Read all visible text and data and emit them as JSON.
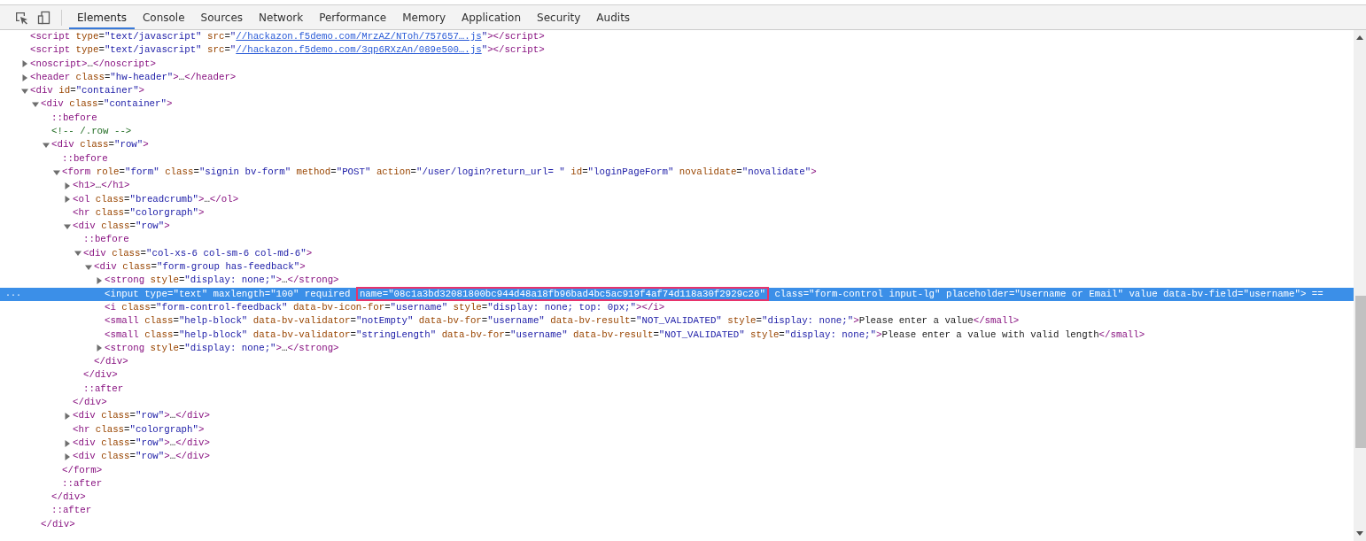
{
  "toolbar": {
    "tabs": [
      {
        "label": "Elements",
        "selected": true
      },
      {
        "label": "Console",
        "selected": false
      },
      {
        "label": "Sources",
        "selected": false
      },
      {
        "label": "Network",
        "selected": false
      },
      {
        "label": "Performance",
        "selected": false
      },
      {
        "label": "Memory",
        "selected": false
      },
      {
        "label": "Application",
        "selected": false
      },
      {
        "label": "Security",
        "selected": false
      },
      {
        "label": "Audits",
        "selected": false
      }
    ]
  },
  "tree": [
    {
      "selected": false,
      "line": [
        {
          "kind": "tag",
          "text": "<script"
        },
        {
          "kind": "attr",
          "text": " type"
        },
        {
          "kind": "text",
          "text": "="
        },
        {
          "kind": "val",
          "text": "\"text/javascript\""
        },
        {
          "kind": "attr",
          "text": " src"
        },
        {
          "kind": "text",
          "text": "="
        },
        {
          "kind": "val",
          "text": "\""
        },
        {
          "kind": "link",
          "text": "//hackazon.f5demo.com/MrzAZ/NToh/757657….js"
        },
        {
          "kind": "val",
          "text": "\""
        },
        {
          "kind": "tag",
          "text": "></script>"
        }
      ]
    },
    {
      "selected": false,
      "line": [
        {
          "kind": "tag",
          "text": "<script"
        },
        {
          "kind": "attr",
          "text": " type"
        },
        {
          "kind": "text",
          "text": "="
        },
        {
          "kind": "val",
          "text": "\"text/javascript\""
        },
        {
          "kind": "attr",
          "text": " src"
        },
        {
          "kind": "text",
          "text": "="
        },
        {
          "kind": "val",
          "text": "\""
        },
        {
          "kind": "link",
          "text": "//hackazon.f5demo.com/3qp6RXzAn/089e500….js"
        },
        {
          "kind": "val",
          "text": "\""
        },
        {
          "kind": "tag",
          "text": "></script>"
        }
      ]
    },
    {
      "selected": false,
      "expanded": false,
      "line": [
        {
          "kind": "tag",
          "text": "<noscript>"
        },
        {
          "kind": "text",
          "text": "…"
        },
        {
          "kind": "tag",
          "text": "</noscript>"
        }
      ]
    },
    {
      "selected": false,
      "expanded": false,
      "line": [
        {
          "kind": "tag",
          "text": "<header"
        },
        {
          "kind": "attr",
          "text": " class"
        },
        {
          "kind": "text",
          "text": "="
        },
        {
          "kind": "val",
          "text": "\"hw-header\""
        },
        {
          "kind": "tag",
          "text": ">"
        },
        {
          "kind": "text",
          "text": "…"
        },
        {
          "kind": "tag",
          "text": "</header>"
        }
      ]
    },
    {
      "selected": false,
      "expanded": true,
      "line": [
        {
          "kind": "tag",
          "text": "<div"
        },
        {
          "kind": "attr",
          "text": " id"
        },
        {
          "kind": "text",
          "text": "="
        },
        {
          "kind": "val",
          "text": "\"container\""
        },
        {
          "kind": "tag",
          "text": ">"
        }
      ],
      "children": [
        {
          "selected": false,
          "expanded": true,
          "line": [
            {
              "kind": "tag",
              "text": "<div"
            },
            {
              "kind": "attr",
              "text": " class"
            },
            {
              "kind": "text",
              "text": "="
            },
            {
              "kind": "val",
              "text": "\"container\""
            },
            {
              "kind": "tag",
              "text": ">"
            }
          ],
          "close": [
            {
              "kind": "tag",
              "text": "</div>"
            }
          ],
          "children": [
            {
              "selected": false,
              "line": [
                {
                  "kind": "pseudo",
                  "text": "::before"
                }
              ]
            },
            {
              "selected": false,
              "line": [
                {
                  "kind": "comment",
                  "text": "<!-- /.row -->"
                }
              ]
            },
            {
              "selected": false,
              "expanded": true,
              "line": [
                {
                  "kind": "tag",
                  "text": "<div"
                },
                {
                  "kind": "attr",
                  "text": " class"
                },
                {
                  "kind": "text",
                  "text": "="
                },
                {
                  "kind": "val",
                  "text": "\"row\""
                },
                {
                  "kind": "tag",
                  "text": ">"
                }
              ],
              "close": [
                {
                  "kind": "tag",
                  "text": "</div>"
                }
              ],
              "children": [
                {
                  "selected": false,
                  "line": [
                    {
                      "kind": "pseudo",
                      "text": "::before"
                    }
                  ]
                },
                {
                  "selected": false,
                  "expanded": true,
                  "line": [
                    {
                      "kind": "tag",
                      "text": "<form"
                    },
                    {
                      "kind": "attr",
                      "text": " role"
                    },
                    {
                      "kind": "text",
                      "text": "="
                    },
                    {
                      "kind": "val",
                      "text": "\"form\""
                    },
                    {
                      "kind": "attr",
                      "text": " class"
                    },
                    {
                      "kind": "text",
                      "text": "="
                    },
                    {
                      "kind": "val",
                      "text": "\"signin bv-form\""
                    },
                    {
                      "kind": "attr",
                      "text": " method"
                    },
                    {
                      "kind": "text",
                      "text": "="
                    },
                    {
                      "kind": "val",
                      "text": "\"POST\""
                    },
                    {
                      "kind": "attr",
                      "text": " action"
                    },
                    {
                      "kind": "text",
                      "text": "="
                    },
                    {
                      "kind": "val",
                      "text": "\"/user/login?return_url= \""
                    },
                    {
                      "kind": "attr",
                      "text": " id"
                    },
                    {
                      "kind": "text",
                      "text": "="
                    },
                    {
                      "kind": "val",
                      "text": "\"loginPageForm\""
                    },
                    {
                      "kind": "attr",
                      "text": " novalidate"
                    },
                    {
                      "kind": "text",
                      "text": "="
                    },
                    {
                      "kind": "val",
                      "text": "\"novalidate\""
                    },
                    {
                      "kind": "tag",
                      "text": ">"
                    }
                  ],
                  "close": [
                    {
                      "kind": "tag",
                      "text": "</form>"
                    }
                  ],
                  "children": [
                    {
                      "selected": false,
                      "expanded": false,
                      "line": [
                        {
                          "kind": "tag",
                          "text": "<h1>"
                        },
                        {
                          "kind": "text",
                          "text": "…"
                        },
                        {
                          "kind": "tag",
                          "text": "</h1>"
                        }
                      ]
                    },
                    {
                      "selected": false,
                      "expanded": false,
                      "line": [
                        {
                          "kind": "tag",
                          "text": "<ol"
                        },
                        {
                          "kind": "attr",
                          "text": " class"
                        },
                        {
                          "kind": "text",
                          "text": "="
                        },
                        {
                          "kind": "val",
                          "text": "\"breadcrumb\""
                        },
                        {
                          "kind": "tag",
                          "text": ">"
                        },
                        {
                          "kind": "text",
                          "text": "…"
                        },
                        {
                          "kind": "tag",
                          "text": "</ol>"
                        }
                      ]
                    },
                    {
                      "selected": false,
                      "line": [
                        {
                          "kind": "tag",
                          "text": "<hr"
                        },
                        {
                          "kind": "attr",
                          "text": " class"
                        },
                        {
                          "kind": "text",
                          "text": "="
                        },
                        {
                          "kind": "val",
                          "text": "\"colorgraph\""
                        },
                        {
                          "kind": "tag",
                          "text": ">"
                        }
                      ]
                    },
                    {
                      "selected": false,
                      "expanded": true,
                      "line": [
                        {
                          "kind": "tag",
                          "text": "<div"
                        },
                        {
                          "kind": "attr",
                          "text": " class"
                        },
                        {
                          "kind": "text",
                          "text": "="
                        },
                        {
                          "kind": "val",
                          "text": "\"row\""
                        },
                        {
                          "kind": "tag",
                          "text": ">"
                        }
                      ],
                      "close": [
                        {
                          "kind": "tag",
                          "text": "</div>"
                        }
                      ],
                      "children": [
                        {
                          "selected": false,
                          "line": [
                            {
                              "kind": "pseudo",
                              "text": "::before"
                            }
                          ]
                        },
                        {
                          "selected": false,
                          "expanded": true,
                          "line": [
                            {
                              "kind": "tag",
                              "text": "<div"
                            },
                            {
                              "kind": "attr",
                              "text": " class"
                            },
                            {
                              "kind": "text",
                              "text": "="
                            },
                            {
                              "kind": "val",
                              "text": "\"col-xs-6 col-sm-6 col-md-6\""
                            },
                            {
                              "kind": "tag",
                              "text": ">"
                            }
                          ],
                          "close": [
                            {
                              "kind": "tag",
                              "text": "</div>"
                            }
                          ],
                          "children": [
                            {
                              "selected": false,
                              "expanded": true,
                              "line": [
                                {
                                  "kind": "tag",
                                  "text": "<div"
                                },
                                {
                                  "kind": "attr",
                                  "text": " class"
                                },
                                {
                                  "kind": "text",
                                  "text": "="
                                },
                                {
                                  "kind": "val",
                                  "text": "\"form-group has-feedback\""
                                },
                                {
                                  "kind": "tag",
                                  "text": ">"
                                }
                              ],
                              "close": [
                                {
                                  "kind": "tag",
                                  "text": "</div>"
                                }
                              ],
                              "children": [
                                {
                                  "selected": false,
                                  "expanded": false,
                                  "line": [
                                    {
                                      "kind": "tag",
                                      "text": "<strong"
                                    },
                                    {
                                      "kind": "attr",
                                      "text": " style"
                                    },
                                    {
                                      "kind": "text",
                                      "text": "="
                                    },
                                    {
                                      "kind": "val",
                                      "text": "\"display: none;\""
                                    },
                                    {
                                      "kind": "tag",
                                      "text": ">"
                                    },
                                    {
                                      "kind": "text",
                                      "text": "…"
                                    },
                                    {
                                      "kind": "tag",
                                      "text": "</strong>"
                                    }
                                  ]
                                },
                                {
                                  "selected": true,
                                  "gutter": "...",
                                  "line": [
                                    {
                                      "kind": "tag",
                                      "text": "<input"
                                    },
                                    {
                                      "kind": "attr",
                                      "text": " type"
                                    },
                                    {
                                      "kind": "text",
                                      "text": "="
                                    },
                                    {
                                      "kind": "val",
                                      "text": "\"text\""
                                    },
                                    {
                                      "kind": "attr",
                                      "text": " maxlength"
                                    },
                                    {
                                      "kind": "text",
                                      "text": "="
                                    },
                                    {
                                      "kind": "val",
                                      "text": "\"100\""
                                    },
                                    {
                                      "kind": "attr",
                                      "text": " required "
                                    },
                                    {
                                      "kind": "box",
                                      "text": "name=\"08c1a3bd32081800bc944d48a18fb96bad4bc5ac919f4af74d118a30f2929c26\""
                                    },
                                    {
                                      "kind": "attr",
                                      "text": " class"
                                    },
                                    {
                                      "kind": "text",
                                      "text": "="
                                    },
                                    {
                                      "kind": "val",
                                      "text": "\"form-control input-lg\""
                                    },
                                    {
                                      "kind": "attr",
                                      "text": " placeholder"
                                    },
                                    {
                                      "kind": "text",
                                      "text": "="
                                    },
                                    {
                                      "kind": "val",
                                      "text": "\"Username or Email\""
                                    },
                                    {
                                      "kind": "attr",
                                      "text": " value"
                                    },
                                    {
                                      "kind": "attr",
                                      "text": " data-bv-field"
                                    },
                                    {
                                      "kind": "text",
                                      "text": "="
                                    },
                                    {
                                      "kind": "val",
                                      "text": "\"username\""
                                    },
                                    {
                                      "kind": "tag",
                                      "text": ">"
                                    },
                                    {
                                      "kind": "text",
                                      "text": " =="
                                    }
                                  ]
                                },
                                {
                                  "selected": false,
                                  "line": [
                                    {
                                      "kind": "tag",
                                      "text": "<i"
                                    },
                                    {
                                      "kind": "attr",
                                      "text": " class"
                                    },
                                    {
                                      "kind": "text",
                                      "text": "="
                                    },
                                    {
                                      "kind": "val",
                                      "text": "\"form-control-feedback\""
                                    },
                                    {
                                      "kind": "attr",
                                      "text": " data-bv-icon-for"
                                    },
                                    {
                                      "kind": "text",
                                      "text": "="
                                    },
                                    {
                                      "kind": "val",
                                      "text": "\"username\""
                                    },
                                    {
                                      "kind": "attr",
                                      "text": " style"
                                    },
                                    {
                                      "kind": "text",
                                      "text": "="
                                    },
                                    {
                                      "kind": "val",
                                      "text": "\"display: none; top: 0px;\""
                                    },
                                    {
                                      "kind": "tag",
                                      "text": "></i>"
                                    }
                                  ]
                                },
                                {
                                  "selected": false,
                                  "line": [
                                    {
                                      "kind": "tag",
                                      "text": "<small"
                                    },
                                    {
                                      "kind": "attr",
                                      "text": " class"
                                    },
                                    {
                                      "kind": "text",
                                      "text": "="
                                    },
                                    {
                                      "kind": "val",
                                      "text": "\"help-block\""
                                    },
                                    {
                                      "kind": "attr",
                                      "text": " data-bv-validator"
                                    },
                                    {
                                      "kind": "text",
                                      "text": "="
                                    },
                                    {
                                      "kind": "val",
                                      "text": "\"notEmpty\""
                                    },
                                    {
                                      "kind": "attr",
                                      "text": " data-bv-for"
                                    },
                                    {
                                      "kind": "text",
                                      "text": "="
                                    },
                                    {
                                      "kind": "val",
                                      "text": "\"username\""
                                    },
                                    {
                                      "kind": "attr",
                                      "text": " data-bv-result"
                                    },
                                    {
                                      "kind": "text",
                                      "text": "="
                                    },
                                    {
                                      "kind": "val",
                                      "text": "\"NOT_VALIDATED\""
                                    },
                                    {
                                      "kind": "attr",
                                      "text": " style"
                                    },
                                    {
                                      "kind": "text",
                                      "text": "="
                                    },
                                    {
                                      "kind": "val",
                                      "text": "\"display: none;\""
                                    },
                                    {
                                      "kind": "tag",
                                      "text": ">"
                                    },
                                    {
                                      "kind": "text",
                                      "text": "Please enter a value"
                                    },
                                    {
                                      "kind": "tag",
                                      "text": "</small>"
                                    }
                                  ]
                                },
                                {
                                  "selected": false,
                                  "line": [
                                    {
                                      "kind": "tag",
                                      "text": "<small"
                                    },
                                    {
                                      "kind": "attr",
                                      "text": " class"
                                    },
                                    {
                                      "kind": "text",
                                      "text": "="
                                    },
                                    {
                                      "kind": "val",
                                      "text": "\"help-block\""
                                    },
                                    {
                                      "kind": "attr",
                                      "text": " data-bv-validator"
                                    },
                                    {
                                      "kind": "text",
                                      "text": "="
                                    },
                                    {
                                      "kind": "val",
                                      "text": "\"stringLength\""
                                    },
                                    {
                                      "kind": "attr",
                                      "text": " data-bv-for"
                                    },
                                    {
                                      "kind": "text",
                                      "text": "="
                                    },
                                    {
                                      "kind": "val",
                                      "text": "\"username\""
                                    },
                                    {
                                      "kind": "attr",
                                      "text": " data-bv-result"
                                    },
                                    {
                                      "kind": "text",
                                      "text": "="
                                    },
                                    {
                                      "kind": "val",
                                      "text": "\"NOT_VALIDATED\""
                                    },
                                    {
                                      "kind": "attr",
                                      "text": " style"
                                    },
                                    {
                                      "kind": "text",
                                      "text": "="
                                    },
                                    {
                                      "kind": "val",
                                      "text": "\"display: none;\""
                                    },
                                    {
                                      "kind": "tag",
                                      "text": ">"
                                    },
                                    {
                                      "kind": "text",
                                      "text": "Please enter a value with valid length"
                                    },
                                    {
                                      "kind": "tag",
                                      "text": "</small>"
                                    }
                                  ]
                                },
                                {
                                  "selected": false,
                                  "expanded": false,
                                  "line": [
                                    {
                                      "kind": "tag",
                                      "text": "<strong"
                                    },
                                    {
                                      "kind": "attr",
                                      "text": " style"
                                    },
                                    {
                                      "kind": "text",
                                      "text": "="
                                    },
                                    {
                                      "kind": "val",
                                      "text": "\"display: none;\""
                                    },
                                    {
                                      "kind": "tag",
                                      "text": ">"
                                    },
                                    {
                                      "kind": "text",
                                      "text": "…"
                                    },
                                    {
                                      "kind": "tag",
                                      "text": "</strong>"
                                    }
                                  ]
                                }
                              ]
                            }
                          ]
                        },
                        {
                          "selected": false,
                          "line": [
                            {
                              "kind": "pseudo",
                              "text": "::after"
                            }
                          ]
                        }
                      ]
                    },
                    {
                      "selected": false,
                      "expanded": false,
                      "line": [
                        {
                          "kind": "tag",
                          "text": "<div"
                        },
                        {
                          "kind": "attr",
                          "text": " class"
                        },
                        {
                          "kind": "text",
                          "text": "="
                        },
                        {
                          "kind": "val",
                          "text": "\"row\""
                        },
                        {
                          "kind": "tag",
                          "text": ">"
                        },
                        {
                          "kind": "text",
                          "text": "…"
                        },
                        {
                          "kind": "tag",
                          "text": "</div>"
                        }
                      ]
                    },
                    {
                      "selected": false,
                      "line": [
                        {
                          "kind": "tag",
                          "text": "<hr"
                        },
                        {
                          "kind": "attr",
                          "text": " class"
                        },
                        {
                          "kind": "text",
                          "text": "="
                        },
                        {
                          "kind": "val",
                          "text": "\"colorgraph\""
                        },
                        {
                          "kind": "tag",
                          "text": ">"
                        }
                      ]
                    },
                    {
                      "selected": false,
                      "expanded": false,
                      "line": [
                        {
                          "kind": "tag",
                          "text": "<div"
                        },
                        {
                          "kind": "attr",
                          "text": " class"
                        },
                        {
                          "kind": "text",
                          "text": "="
                        },
                        {
                          "kind": "val",
                          "text": "\"row\""
                        },
                        {
                          "kind": "tag",
                          "text": ">"
                        },
                        {
                          "kind": "text",
                          "text": "…"
                        },
                        {
                          "kind": "tag",
                          "text": "</div>"
                        }
                      ]
                    },
                    {
                      "selected": false,
                      "expanded": false,
                      "line": [
                        {
                          "kind": "tag",
                          "text": "<div"
                        },
                        {
                          "kind": "attr",
                          "text": " class"
                        },
                        {
                          "kind": "text",
                          "text": "="
                        },
                        {
                          "kind": "val",
                          "text": "\"row\""
                        },
                        {
                          "kind": "tag",
                          "text": ">"
                        },
                        {
                          "kind": "text",
                          "text": "…"
                        },
                        {
                          "kind": "tag",
                          "text": "</div>"
                        }
                      ]
                    }
                  ]
                },
                {
                  "selected": false,
                  "line": [
                    {
                      "kind": "pseudo",
                      "text": "::after"
                    }
                  ]
                }
              ]
            },
            {
              "selected": false,
              "line": [
                {
                  "kind": "pseudo",
                  "text": "::after"
                }
              ]
            }
          ]
        }
      ]
    }
  ]
}
